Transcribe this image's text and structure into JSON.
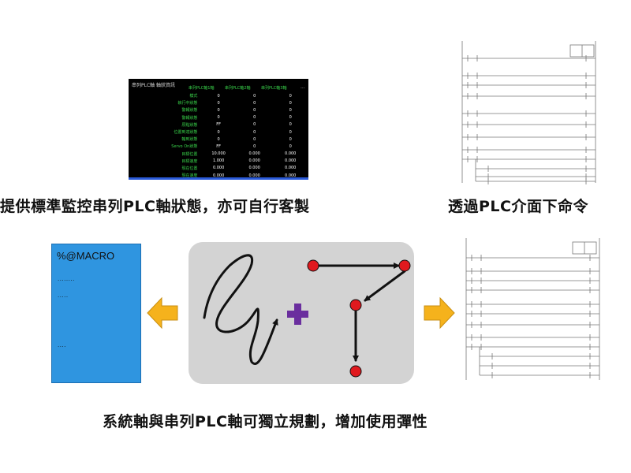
{
  "status_panel": {
    "title": "串列PLC軸 軸狀資訊",
    "columns": [
      "串列PLC軸1軸",
      "串列PLC軸2軸",
      "串列PLC軸3軸"
    ],
    "more": "...",
    "rows": [
      {
        "label": "模式",
        "values": [
          "0",
          "0",
          "0"
        ]
      },
      {
        "label": "執行中狀態",
        "values": [
          "0",
          "0",
          "0"
        ]
      },
      {
        "label": "警報狀態",
        "values": [
          "0",
          "0",
          "0"
        ]
      },
      {
        "label": "警報狀態",
        "values": [
          "0",
          "0",
          "0"
        ]
      },
      {
        "label": "原點狀態",
        "values": [
          "FF",
          "0",
          "0"
        ]
      },
      {
        "label": "位置到達狀態",
        "values": [
          "0",
          "0",
          "0"
        ]
      },
      {
        "label": "軸到狀態",
        "values": [
          "0",
          "0",
          "0"
        ]
      },
      {
        "label": "Servo On狀態",
        "values": [
          "FF",
          "0",
          "0"
        ]
      },
      {
        "label": "目標位置",
        "values": [
          "10.000",
          "0.000",
          "0.000"
        ]
      },
      {
        "label": "目標速度",
        "values": [
          "1.000",
          "0.000",
          "0.000"
        ]
      },
      {
        "label": "現在位置",
        "values": [
          "0.000",
          "0.000",
          "0.000"
        ]
      },
      {
        "label": "現在速度",
        "values": [
          "0.000",
          "0.000",
          "0.000"
        ]
      }
    ]
  },
  "captions": {
    "left": "提供標準監控串列PLC軸狀態，亦可自行客製",
    "right": "透過PLC介面下命令",
    "bottom": "系統軸與串列PLC軸可獨立規劃，增加使用彈性"
  },
  "macro_doc": {
    "header": "%@MACRO",
    "line1": "........",
    "line2": ".....",
    "line3": "...."
  },
  "colors": {
    "arrow": "#f5b21c",
    "plus": "#6a2e9e",
    "node": "#e0191e",
    "macro_bg": "#2f95e0",
    "panel_bg": "#d3d3d3",
    "monitor_label": "#39d24a"
  }
}
